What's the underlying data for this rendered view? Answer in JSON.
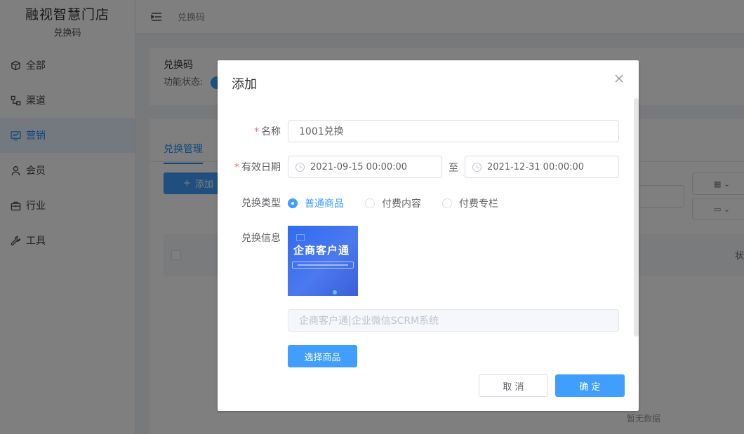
{
  "sidebar": {
    "brand_title": "融视智慧门店",
    "brand_subtitle": "兑换码",
    "items": [
      {
        "label": "全部",
        "icon": "cube-icon"
      },
      {
        "label": "渠道",
        "icon": "channel-icon"
      },
      {
        "label": "营销",
        "icon": "marketing-icon",
        "active": true
      },
      {
        "label": "会员",
        "icon": "user-icon"
      },
      {
        "label": "行业",
        "icon": "briefcase-icon"
      },
      {
        "label": "工具",
        "icon": "wrench-icon"
      }
    ]
  },
  "topbar": {
    "breadcrumb": "兑换码"
  },
  "background": {
    "card_title": "兑换码",
    "feature_status_label": "功能状态:",
    "tab_label": "兑换管理",
    "add_button": "添加",
    "table_state_header": "状",
    "empty_text": "暂无数据"
  },
  "dialog": {
    "title": "添加",
    "name_label": "名称",
    "name_value": "1001兑换",
    "date_label": "有效日期",
    "start_date": "2021-09-15 00:00:00",
    "date_separator": "至",
    "end_date": "2021-12-31 00:00:00",
    "type_label": "兑换类型",
    "type_options": [
      "普通商品",
      "付费内容",
      "付费专栏"
    ],
    "type_selected": "普通商品",
    "info_label": "兑换信息",
    "product_image_text": "企商客户通",
    "product_name": "企商客户通|企业微信SCRM系统",
    "select_product_button": "选择商品",
    "cancel_button": "取 消",
    "confirm_button": "确 定"
  },
  "colors": {
    "primary": "#409eff",
    "required": "#f56c6c"
  }
}
